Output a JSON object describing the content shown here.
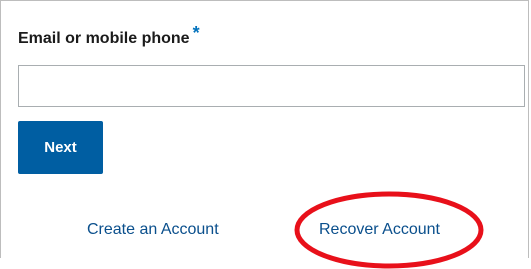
{
  "form": {
    "field_label": "Email or mobile phone",
    "required_marker": "*",
    "email_value": "",
    "next_label": "Next"
  },
  "links": {
    "create_account": "Create an Account",
    "recover_account": "Recover Account"
  },
  "colors": {
    "primary_button": "#005ea2",
    "link": "#0a4f8c",
    "required_star": "#0071bc",
    "annotation_circle": "#e8101a"
  }
}
